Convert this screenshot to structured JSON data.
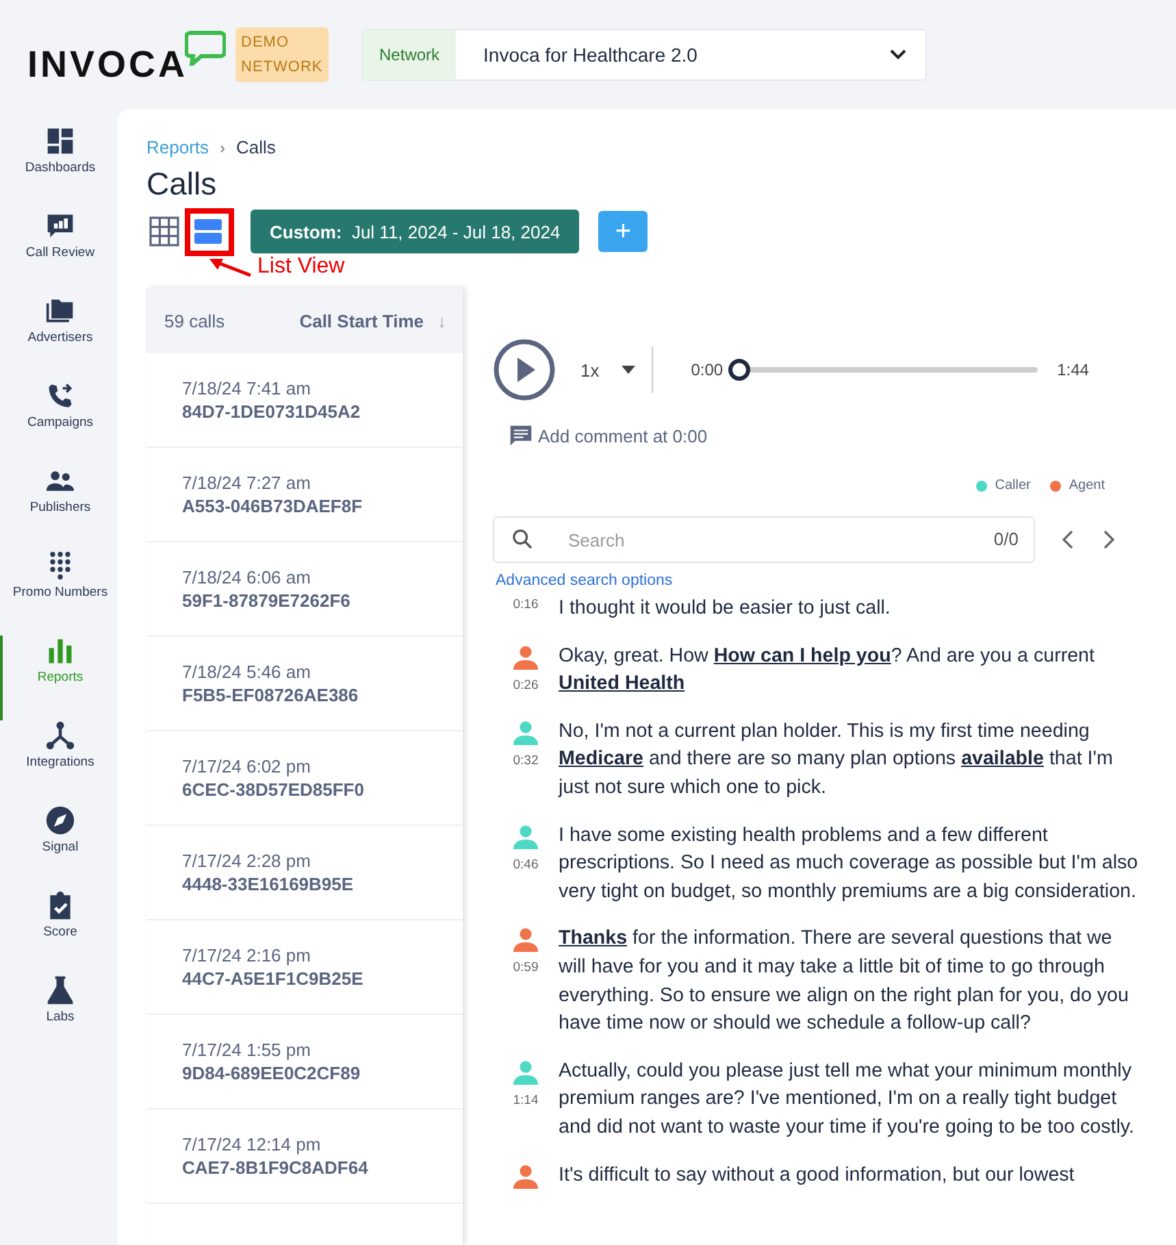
{
  "header": {
    "logo": "INVOCA",
    "demo_badge": "DEMO NETWORK",
    "network_label": "Network",
    "network_value": "Invoca for Healthcare 2.0"
  },
  "sidebar": {
    "items": [
      {
        "label": "Dashboards",
        "selected": false
      },
      {
        "label": "Call Review",
        "selected": false
      },
      {
        "label": "Advertisers",
        "selected": false
      },
      {
        "label": "Campaigns",
        "selected": false
      },
      {
        "label": "Publishers",
        "selected": false
      },
      {
        "label": "Promo Numbers",
        "selected": false
      },
      {
        "label": "Reports",
        "selected": true
      },
      {
        "label": "Integrations",
        "selected": false
      },
      {
        "label": "Signal",
        "selected": false
      },
      {
        "label": "Score",
        "selected": false
      },
      {
        "label": "Labs",
        "selected": false
      }
    ]
  },
  "breadcrumb": {
    "link": "Reports",
    "separator": "›",
    "current": "Calls"
  },
  "page_title": "Calls",
  "view_toggle": [
    {
      "kind": "grid",
      "selected": false
    },
    {
      "kind": "list",
      "selected": true
    }
  ],
  "date_range": {
    "label": "Custom:",
    "value": "Jul 11, 2024 - Jul 18, 2024"
  },
  "add_button": "+",
  "annotation": {
    "text": "List View"
  },
  "call_list": {
    "count": "59 calls",
    "sort_label": "Call Start Time",
    "sort_arrow": "↓",
    "rows": [
      {
        "time": "7/18/24 7:41 am",
        "id": "84D7-1DE0731D45A2"
      },
      {
        "time": "7/18/24 7:27 am",
        "id": "A553-046B73DAEF8F"
      },
      {
        "time": "7/18/24 6:06 am",
        "id": "59F1-87879E7262F6"
      },
      {
        "time": "7/18/24 5:46 am",
        "id": "F5B5-EF08726AE386"
      },
      {
        "time": "7/17/24 6:02 pm",
        "id": "6CEC-38D57ED85FF0"
      },
      {
        "time": "7/17/24 2:28 pm",
        "id": "4448-33E16169B95E"
      },
      {
        "time": "7/17/24 2:16 pm",
        "id": "44C7-A5E1F1C9B25E"
      },
      {
        "time": "7/17/24 1:55 pm",
        "id": "9D84-689EE0C2CF89"
      },
      {
        "time": "7/17/24 12:14 pm",
        "id": "CAE7-8B1F9C8ADF64"
      }
    ]
  },
  "player": {
    "speed": "1x",
    "current": "0:00",
    "duration": "1:44",
    "level": 0
  },
  "comment": "Add comment at 0:00",
  "legend": [
    {
      "label": "Caller",
      "color": "#4dd9c4"
    },
    {
      "label": "Agent",
      "color": "#f0734a"
    }
  ],
  "search": {
    "placeholder": "Search",
    "count": "0/0"
  },
  "advanced_search": "Advanced search options",
  "transcript": [
    {
      "time": "0:16",
      "text": "I thought it would be easier to just call."
    },
    {
      "time": "0:26",
      "color": "#f0734a",
      "text": "Okay, great. How **How can I help you**? And are you a current **United Health**"
    },
    {
      "time": "0:32",
      "color": "#4dd9c4",
      "text": "No, I'm not a current plan holder. This is my first time needing **Medicare** and there are so many plan options **available** that I'm just not sure which one to pick."
    },
    {
      "time": "0:46",
      "color": "#4dd9c4",
      "text": "I have some existing health problems and a few different prescriptions. So I need as much coverage as possible but I'm also very tight on budget, so monthly premiums are a big consideration."
    },
    {
      "time": "0:59",
      "color": "#f0734a",
      "text": "**Thanks** for the information. There are several questions that we will have for you and it may take a little bit of time to go through everything. So to ensure we align on the right plan for you, do you have time now or should we schedule a follow-up call?"
    },
    {
      "time": "1:14",
      "color": "#4dd9c4",
      "text": "Actually, could you please just tell me what your minimum monthly premium ranges are? I've mentioned, I'm on a really tight budget and did not want to waste your time if you're going to be too costly."
    },
    {
      "color": "#f0734a",
      "text": "It's difficult to say without a good information, but our lowest"
    }
  ]
}
